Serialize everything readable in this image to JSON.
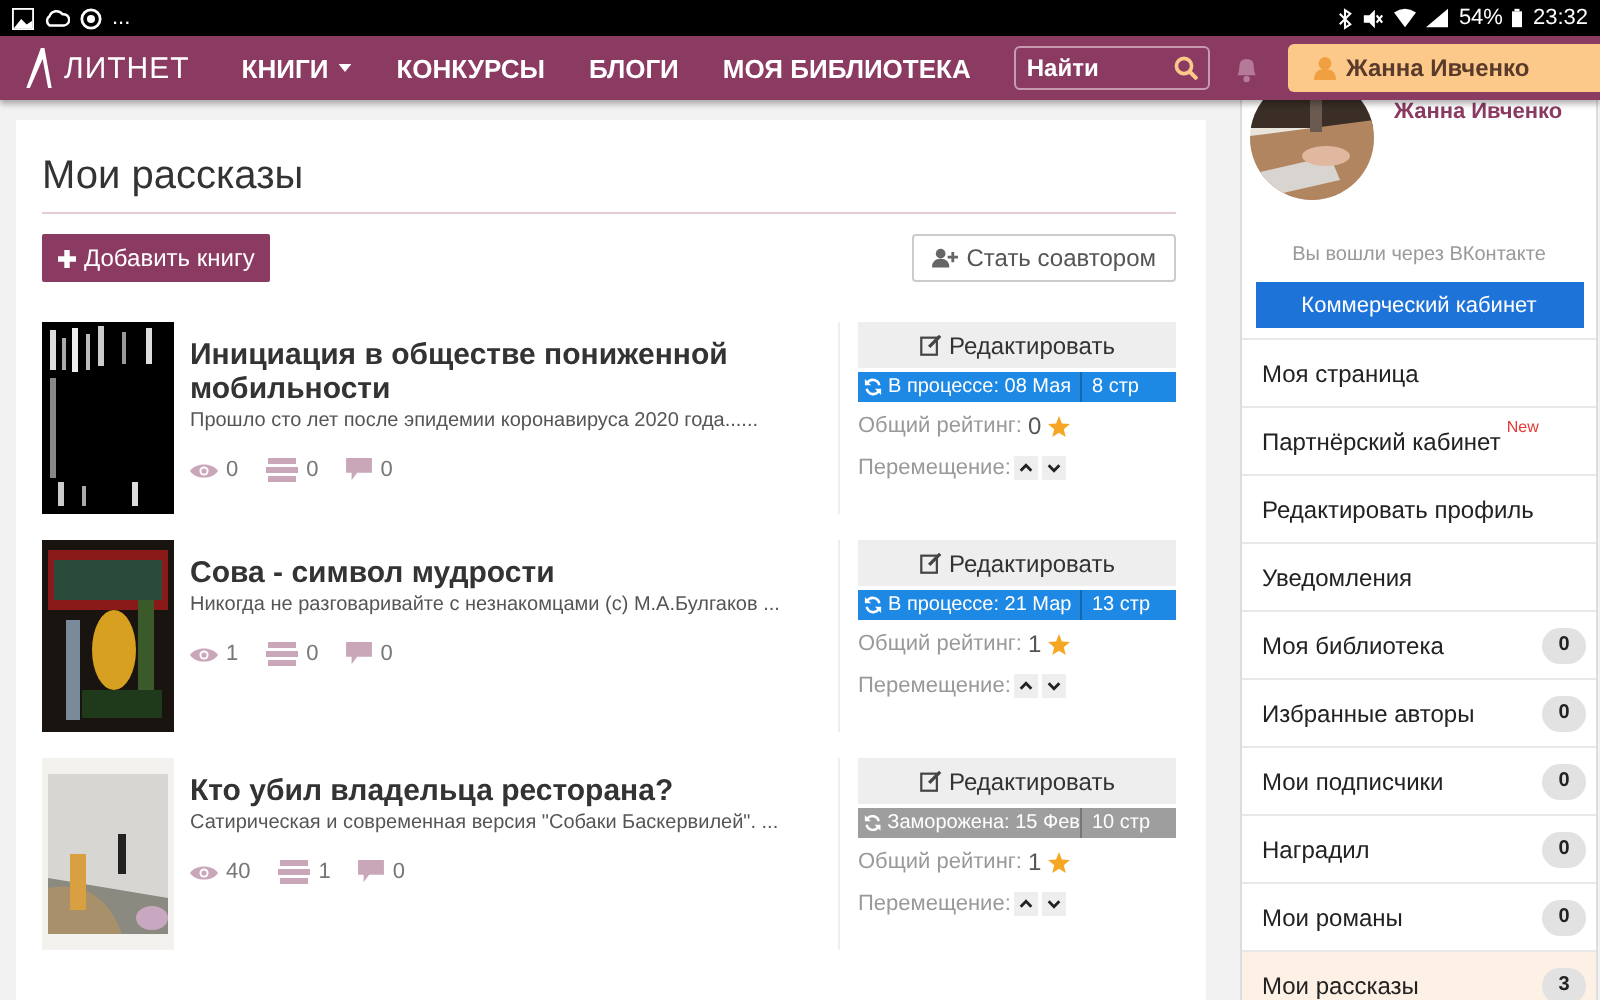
{
  "status_bar": {
    "more": "...",
    "battery": "54%",
    "time": "23:32"
  },
  "navbar": {
    "logo": "ЛИТНЕТ",
    "menu": [
      {
        "label": "КНИГИ",
        "dropdown": true
      },
      {
        "label": "КОНКУРСЫ",
        "dropdown": false
      },
      {
        "label": "БЛОГИ",
        "dropdown": false
      },
      {
        "label": "МОЯ БИБЛИОТЕКА",
        "dropdown": false
      }
    ],
    "search": {
      "placeholder": "Найти"
    },
    "user": "Жанна Ивченко"
  },
  "page": {
    "title": "Мои рассказы",
    "add_button": "Добавить книгу",
    "coauthor_button": "Стать соавтором"
  },
  "books": [
    {
      "title": "Инициация в обществе пониженной мобильности",
      "excerpt": "Прошло сто лет после эпидемии коронавируса 2020 года......",
      "views": "0",
      "libraries": "0",
      "comments": "0",
      "edit": "Редактировать",
      "status": {
        "kind": "in_progress",
        "text": "В процессе: 08 Мая",
        "pages": "8 стр"
      },
      "rating_label": "Общий рейтинг:",
      "rating": "0",
      "move_label": "Перемещение:"
    },
    {
      "title": "Сова - символ мудрости",
      "excerpt": "Никогда не разговаривайте с незнакомцами (с) М.А.Булгаков ...",
      "views": "1",
      "libraries": "0",
      "comments": "0",
      "edit": "Редактировать",
      "status": {
        "kind": "in_progress",
        "text": "В процессе: 21 Мар",
        "pages": "13 стр"
      },
      "rating_label": "Общий рейтинг:",
      "rating": "1",
      "move_label": "Перемещение:"
    },
    {
      "title": "Кто убил владельца ресторана?",
      "excerpt": "Сатирическая и современная версия \"Собаки Баскервилей\". ...",
      "views": "40",
      "libraries": "1",
      "comments": "0",
      "edit": "Редактировать",
      "status": {
        "kind": "frozen",
        "text": "Заморожена: 15 Фев",
        "pages": "10 стр"
      },
      "rating_label": "Общий рейтинг:",
      "rating": "1",
      "move_label": "Перемещение:"
    }
  ],
  "sidebar": {
    "name": "Жанна Ивченко",
    "login_note": "Вы вошли через ВКонтакте",
    "commercial_button": "Коммерческий кабинет",
    "items": [
      {
        "label": "Моя страница",
        "selected": false
      },
      {
        "label": "Партнёрский кабинет",
        "new": "New",
        "selected": false
      },
      {
        "label": "Редактировать профиль",
        "selected": false
      },
      {
        "label": "Уведомления",
        "selected": false
      },
      {
        "label": "Моя библиотека",
        "badge": "0",
        "selected": false
      },
      {
        "label": "Избранные авторы",
        "badge": "0",
        "selected": false
      },
      {
        "label": "Мои подписчики",
        "badge": "0",
        "selected": false
      },
      {
        "label": "Наградил",
        "badge": "0",
        "selected": false
      },
      {
        "label": "Мои романы",
        "badge": "0",
        "selected": false
      },
      {
        "label": "Мои рассказы",
        "badge": "3",
        "selected": true
      }
    ]
  }
}
